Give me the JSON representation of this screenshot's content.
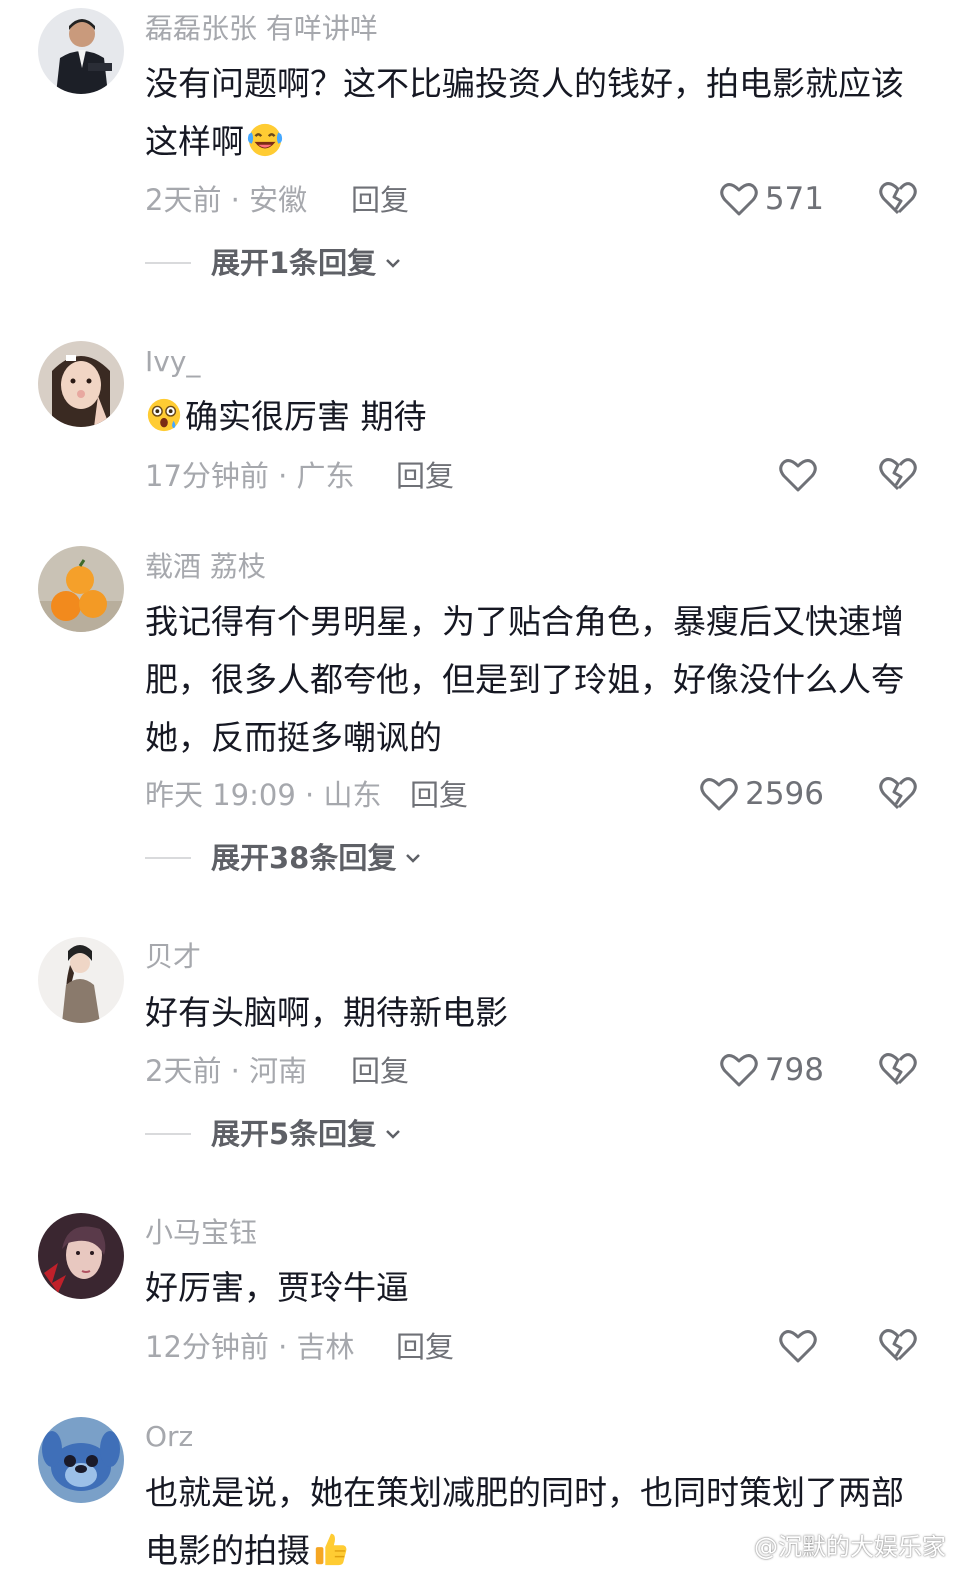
{
  "comments": [
    {
      "username": "磊磊张张 有咩讲咩",
      "text": "没有问题啊？这不比骗投资人的钱好，拍电影就应该这样啊",
      "emoji": "laughing-tears-emoji",
      "meta": "2天前 · 安徽",
      "reply": "回复",
      "likes": "571",
      "expand": "展开1条回复"
    },
    {
      "username": "Ivy_",
      "emoji_lead": "surprised-emoji",
      "text": "确实很厉害 期待",
      "meta": "17分钟前 · 广东",
      "reply": "回复",
      "likes": ""
    },
    {
      "username": "载酒 荔枝",
      "text": "我记得有个男明星，为了贴合角色，暴瘦后又快速增肥，很多人都夸他，但是到了玲姐，好像没什么人夸她，反而挺多嘲讽的",
      "meta": "昨天 19:09 · 山东",
      "reply": "回复",
      "likes": "2596",
      "expand": "展开38条回复"
    },
    {
      "username": "贝才",
      "text": "好有头脑啊，期待新电影",
      "meta": "2天前 · 河南",
      "reply": "回复",
      "likes": "798",
      "expand": "展开5条回复"
    },
    {
      "username": "小马宝钰",
      "text": "好厉害，贾玲牛逼",
      "meta": "12分钟前 · 吉林",
      "reply": "回复",
      "likes": ""
    },
    {
      "username": "Orz",
      "text": "也就是说，她在策划减肥的同时，也同时策划了两部电影的拍摄",
      "emoji": "thumbs-up-emoji",
      "meta": "",
      "reply": "",
      "likes": ""
    }
  ],
  "watermark": "@沉默的大娱乐家",
  "colors": {
    "text": "#161823",
    "secondary": "#a6a8ad",
    "icon": "#6f7177"
  }
}
